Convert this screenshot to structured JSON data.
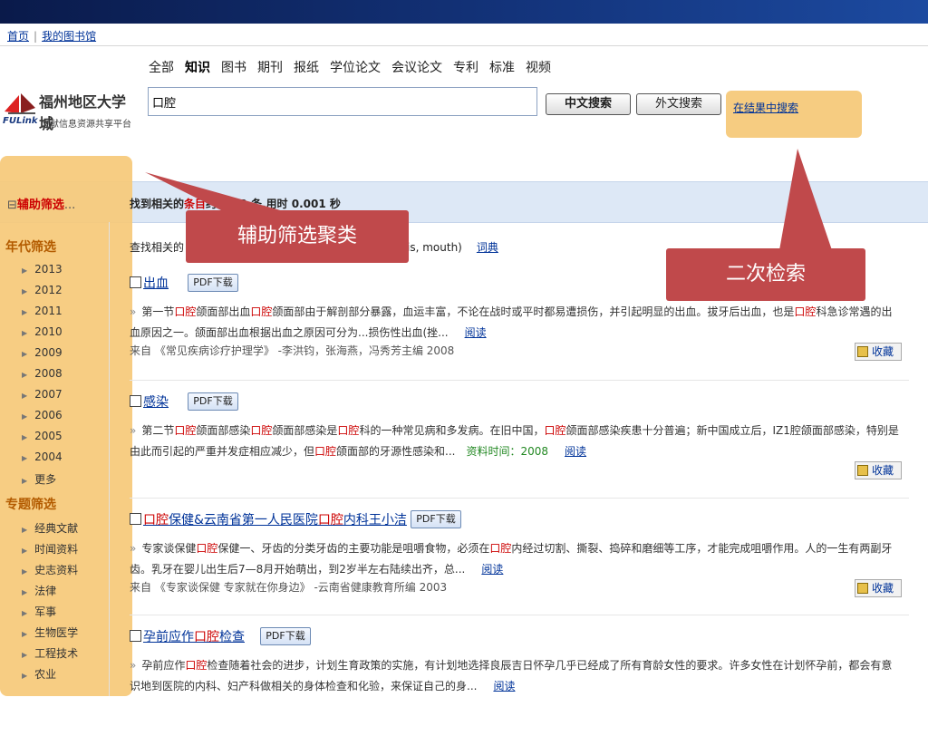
{
  "nav": {
    "home": "首页",
    "sep": "|",
    "my_library": "我的图书馆"
  },
  "logo": {
    "name": "福州地区大学城",
    "brand": "FULink",
    "tagline": "文献信息资源共享平台"
  },
  "categories": [
    {
      "label": "全部",
      "active": false
    },
    {
      "label": "知识",
      "active": true
    },
    {
      "label": "图书",
      "active": false
    },
    {
      "label": "期刊",
      "active": false
    },
    {
      "label": "报纸",
      "active": false
    },
    {
      "label": "学位论文",
      "active": false
    },
    {
      "label": "会议论文",
      "active": false
    },
    {
      "label": "专利",
      "active": false
    },
    {
      "label": "标准",
      "active": false
    },
    {
      "label": "视频",
      "active": false
    }
  ],
  "search": {
    "value": "口腔",
    "cn_button": "中文搜索",
    "foreign_button": "外文搜索",
    "in_results": "在结果中搜索"
  },
  "result_bar": {
    "prefix": "找到相关的",
    "hot": "条目",
    "rest": "约 2.52 条,用时 0.001 秒"
  },
  "aux_filter": {
    "minus": "⊟",
    "label": "辅助筛选",
    "ellipsis": "..."
  },
  "dict_row": {
    "prefix": "查找相关的",
    "terms": "is, mouth)",
    "link": "词典"
  },
  "sidebar": {
    "year_title": "年代筛选",
    "years": [
      "2013",
      "2012",
      "2011",
      "2010",
      "2009",
      "2008",
      "2007",
      "2006",
      "2005",
      "2004",
      "更多"
    ],
    "topic_title": "专题筛选",
    "topics": [
      "经典文献",
      "时闻资料",
      "史志资料",
      "法律",
      "军事",
      "生物医学",
      "工程技术",
      "农业"
    ]
  },
  "results": [
    {
      "title_parts": [
        {
          "t": "出血",
          "hot": false
        }
      ],
      "pdf": "PDF下载",
      "snippet_parts": [
        {
          "t": "第一节",
          "hot": false
        },
        {
          "t": "口腔",
          "hot": true
        },
        {
          "t": "颌面部出血",
          "hot": false
        },
        {
          "t": "口腔",
          "hot": true
        },
        {
          "t": "颌面部由于解剖部分暴露，血运丰富，不论在战时或平时都易遭损伤，并引起明显的出血。拔牙后出血，也是",
          "hot": false
        },
        {
          "t": "口腔",
          "hot": true
        },
        {
          "t": "科急诊常遇的出血原因之一。颌面部出血根据出血之原因可分为...损伤性出血(挫...",
          "hot": false
        }
      ],
      "read": "阅读",
      "source": "来自 《常见疾病诊疗护理学》 -李洪钧，张海燕，冯秀芳主编 2008",
      "fav": "收藏"
    },
    {
      "title_parts": [
        {
          "t": "感染",
          "hot": false
        }
      ],
      "pdf": "PDF下载",
      "snippet_parts": [
        {
          "t": "第二节",
          "hot": false
        },
        {
          "t": "口腔",
          "hot": true
        },
        {
          "t": "颌面部感染",
          "hot": false
        },
        {
          "t": "口腔",
          "hot": true
        },
        {
          "t": "颌面部感染是",
          "hot": false
        },
        {
          "t": "口腔",
          "hot": true
        },
        {
          "t": "科的一种常见病和多发病。在旧中国，",
          "hot": false
        },
        {
          "t": "口腔",
          "hot": true
        },
        {
          "t": "颌面部感染疾患十分普遍；新中国成立后，IZ1腔颌面部感染，特别是由此而引起的严重并发症相应减少，但",
          "hot": false
        },
        {
          "t": "口腔",
          "hot": true
        },
        {
          "t": "颌面部的牙源性感染和...",
          "hot": false
        }
      ],
      "time_label": "资料时间：2008",
      "read": "阅读",
      "source": "",
      "fav": "收藏"
    },
    {
      "title_parts": [
        {
          "t": "口腔",
          "hot": true
        },
        {
          "t": "保健&云南省第一人民医院",
          "hot": false
        },
        {
          "t": "口腔",
          "hot": true
        },
        {
          "t": "内科王小洁",
          "hot": false
        }
      ],
      "pdf": "PDF下载",
      "snippet_parts": [
        {
          "t": "专家谈保健",
          "hot": false
        },
        {
          "t": "口腔",
          "hot": true
        },
        {
          "t": "保健一、牙齿的分类牙齿的主要功能是咀嚼食物，必须在",
          "hot": false
        },
        {
          "t": "口腔",
          "hot": true
        },
        {
          "t": "内经过切割、撕裂、捣碎和磨细等工序，才能完成咀嚼作用。人的一生有两副牙齿。乳牙在婴儿出生后7—8月开始萌出，到2岁半左右陆续出齐，总...",
          "hot": false
        }
      ],
      "read": "阅读",
      "source": "来自 《专家谈保健 专家就在你身边》 -云南省健康教育所编 2003",
      "fav": "收藏"
    },
    {
      "title_parts": [
        {
          "t": "孕前应作",
          "hot": false
        },
        {
          "t": "口腔",
          "hot": true
        },
        {
          "t": "检查",
          "hot": false
        }
      ],
      "pdf": "PDF下载",
      "snippet_parts": [
        {
          "t": "孕前应作",
          "hot": false
        },
        {
          "t": "口腔",
          "hot": true
        },
        {
          "t": "检查随着社会的进步，计划生育政策的实施，有计划地选择良辰吉日怀孕几乎已经成了所有育龄女性的要求。许多女性在计划怀孕前，都会有意识地到医院的内科、妇产科做相关的身体检查和化验，来保证自己的身...",
          "hot": false
        }
      ],
      "read": "阅读",
      "source": "",
      "fav": ""
    }
  ],
  "callouts": {
    "aux": "辅助筛选聚类",
    "secondary": "二次检索"
  },
  "colors": {
    "callout": "#c0494b",
    "highlight": "#f6c97a",
    "link": "#003399",
    "hot": "#cc0000"
  }
}
